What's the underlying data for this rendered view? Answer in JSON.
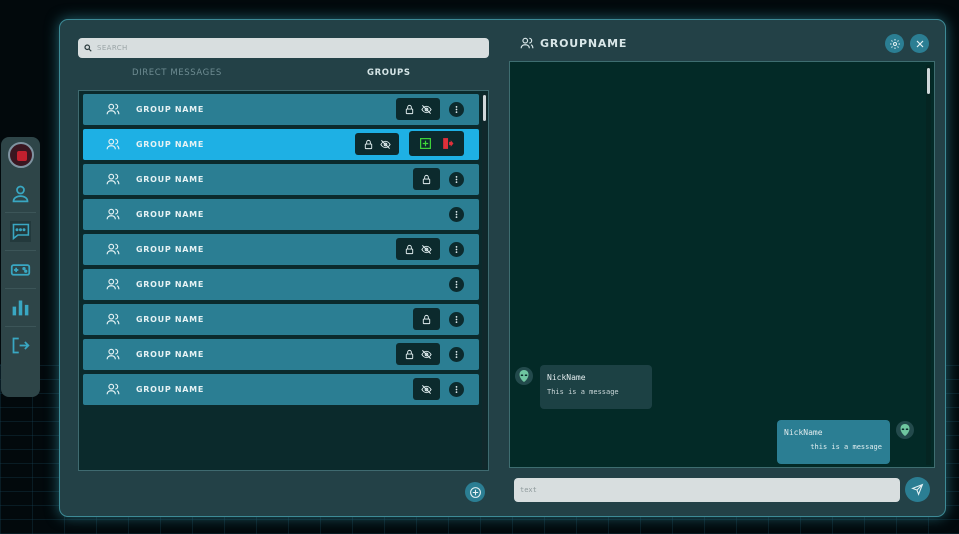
{
  "colors": {
    "accent": "#2b7e93",
    "selected_row": "#1eb0e4",
    "panel": "#234147",
    "chat_bg": "#032a27",
    "invite_green": "#3fd63a",
    "leave_red": "#e0303a"
  },
  "sidenav": {
    "items": [
      {
        "icon": "profile-icon"
      },
      {
        "icon": "chat-icon"
      },
      {
        "icon": "gamepad-icon"
      },
      {
        "icon": "leaderboard-icon"
      },
      {
        "icon": "logout-icon"
      }
    ]
  },
  "search": {
    "placeholder": "SEARCH"
  },
  "tabs": {
    "direct_messages": "DIRECT MESSAGES",
    "groups": "GROUPS"
  },
  "groups": [
    {
      "name": "GROUP NAME",
      "locked": true,
      "hidden": true,
      "selected": false
    },
    {
      "name": "GROUP NAME",
      "locked": true,
      "hidden": true,
      "selected": true
    },
    {
      "name": "GROUP NAME",
      "locked": true,
      "hidden": false,
      "selected": false
    },
    {
      "name": "GROUP NAME",
      "locked": false,
      "hidden": false,
      "selected": false
    },
    {
      "name": "GROUP NAME",
      "locked": true,
      "hidden": true,
      "selected": false
    },
    {
      "name": "GROUP NAME",
      "locked": false,
      "hidden": false,
      "selected": false
    },
    {
      "name": "GROUP NAME",
      "locked": true,
      "hidden": false,
      "selected": false
    },
    {
      "name": "GROUP NAME",
      "locked": true,
      "hidden": true,
      "selected": false
    },
    {
      "name": "GROUP NAME",
      "locked": false,
      "hidden": true,
      "selected": false
    }
  ],
  "chat": {
    "title": "GROUPNAME",
    "messages": [
      {
        "nick": "NickName",
        "text": "This is a message",
        "side": "left"
      },
      {
        "nick": "NickName",
        "text": "this is a message",
        "side": "right"
      }
    ],
    "input_placeholder": "text"
  }
}
